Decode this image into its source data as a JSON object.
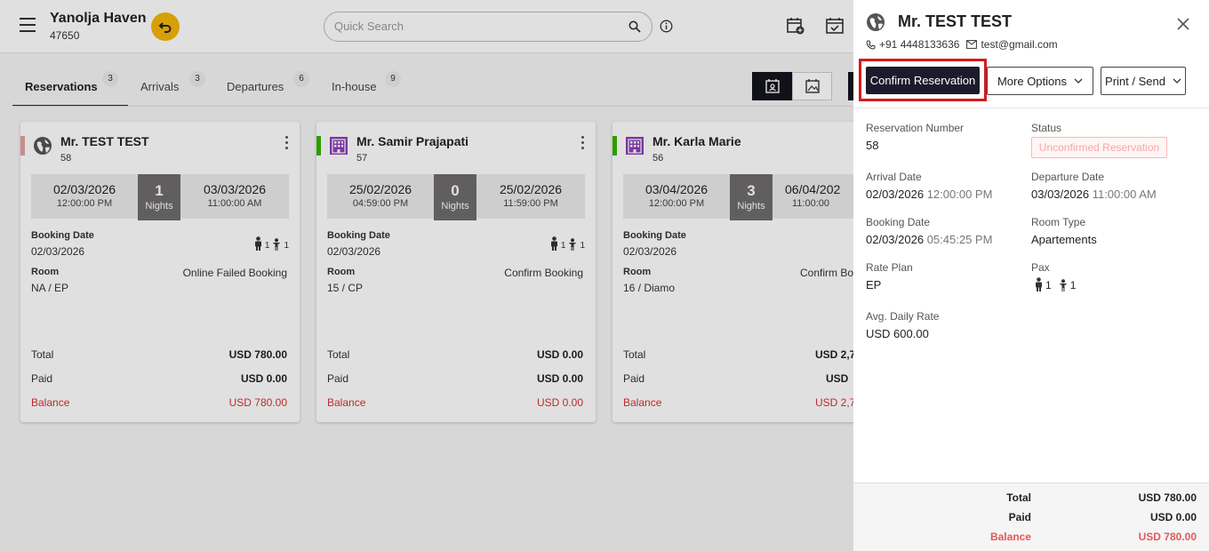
{
  "header": {
    "property_name": "Yanolja Haven",
    "property_id": "47650",
    "search_placeholder": "Quick Search"
  },
  "tabs": [
    {
      "label": "Reservations",
      "count": "3"
    },
    {
      "label": "Arrivals",
      "count": "3"
    },
    {
      "label": "Departures",
      "count": "6"
    },
    {
      "label": "In-house",
      "count": "9"
    }
  ],
  "cards": [
    {
      "name": "Mr. TEST TEST",
      "number": "58",
      "arrival_date": "02/03/2026",
      "arrival_time": "12:00:00 PM",
      "nights": "1",
      "nights_label": "Nights",
      "departure_date": "03/03/2026",
      "departure_time": "11:00:00 AM",
      "booking_date_label": "Booking Date",
      "booking_date": "02/03/2026",
      "adults": "1",
      "children": "1",
      "room_label": "Room",
      "room": "NA / EP",
      "status": "Online Failed Booking",
      "total_label": "Total",
      "total": "USD 780.00",
      "paid_label": "Paid",
      "paid": "USD 0.00",
      "balance_label": "Balance",
      "balance": "USD 780.00",
      "accent_color": "#e8a0a0",
      "icon": "globe-icon"
    },
    {
      "name": "Mr. Samir Prajapati",
      "number": "57",
      "arrival_date": "25/02/2026",
      "arrival_time": "04:59:00 PM",
      "nights": "0",
      "nights_label": "Nights",
      "departure_date": "25/02/2026",
      "departure_time": "11:59:00 PM",
      "booking_date_label": "Booking Date",
      "booking_date": "02/03/2026",
      "adults": "1",
      "children": "1",
      "room_label": "Room",
      "room": "15 / CP",
      "status": "Confirm Booking",
      "total_label": "Total",
      "total": "USD 0.00",
      "paid_label": "Paid",
      "paid": "USD 0.00",
      "balance_label": "Balance",
      "balance": "USD 0.00",
      "accent_color": "#35b300",
      "icon": "building-icon"
    },
    {
      "name": "Mr. Karla Marie",
      "number": "56",
      "arrival_date": "03/04/2026",
      "arrival_time": "12:00:00 PM",
      "nights": "3",
      "nights_label": "Nights",
      "departure_date": "06/04/202",
      "departure_time": "11:00:00",
      "booking_date_label": "Booking Date",
      "booking_date": "02/03/2026",
      "adults": "1",
      "children": "1",
      "room_label": "Room",
      "room": "16 / Diamo",
      "status": "Confirm Bo",
      "total_label": "Total",
      "total": "USD 2,7",
      "paid_label": "Paid",
      "paid": "USD",
      "balance_label": "Balance",
      "balance": "USD 2,7",
      "accent_color": "#35b300",
      "icon": "building-icon"
    }
  ],
  "drawer": {
    "guest_name": "Mr. TEST TEST",
    "phone": "+91 4448133636",
    "email": "test@gmail.com",
    "confirm_button": "Confirm Reservation",
    "more_options_button": "More Options",
    "print_send_button": "Print / Send",
    "fields": {
      "reservation_number_label": "Reservation Number",
      "reservation_number": "58",
      "status_label": "Status",
      "status": "Unconfirmed Reservation",
      "arrival_date_label": "Arrival Date",
      "arrival_date": "02/03/2026",
      "arrival_time": "12:00:00 PM",
      "departure_date_label": "Departure Date",
      "departure_date": "03/03/2026",
      "departure_time": "11:00:00 AM",
      "booking_date_label": "Booking Date",
      "booking_date": "02/03/2026",
      "booking_time": "05:45:25 PM",
      "room_type_label": "Room Type",
      "room_type": "Apartements",
      "rate_plan_label": "Rate Plan",
      "rate_plan": "EP",
      "pax_label": "Pax",
      "pax_adults": "1",
      "pax_children": "1",
      "adr_label": "Avg. Daily Rate",
      "adr": "USD 600.00"
    },
    "footer": {
      "total_label": "Total",
      "total": "USD 780.00",
      "paid_label": "Paid",
      "paid": "USD 0.00",
      "balance_label": "Balance",
      "balance": "USD 780.00"
    }
  },
  "colors": {
    "accent_dark": "#1c1b2b",
    "highlight_red": "#d21c1c",
    "balance_red": "#d9302f",
    "back_button_yellow": "#f5b60a"
  }
}
